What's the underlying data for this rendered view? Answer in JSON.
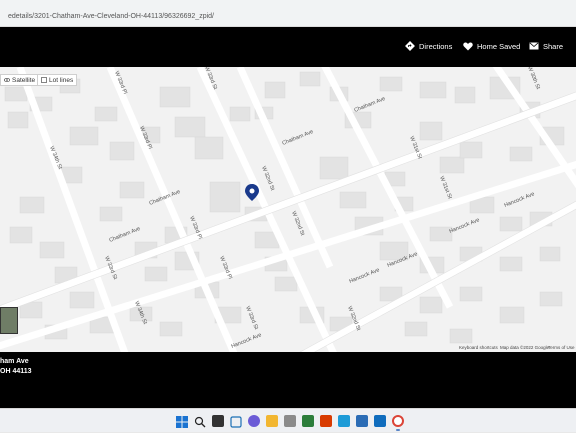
{
  "browser": {
    "url": "edetails/3201-Chatham-Ave-Cleveland-OH-44113/96326692_zpid/"
  },
  "header": {
    "directions_label": "Directions",
    "home_saved_label": "Home Saved",
    "share_label": "Share"
  },
  "map": {
    "satellite_label": "Satellite",
    "lot_lines_label": "Lot lines",
    "streets": {
      "chatham_ave_1": "Chatham Ave",
      "chatham_ave_2": "Chatham Ave",
      "chatham_ave_3": "Chatham Ave",
      "chatham_ave_4": "Chatham Ave",
      "hancock_ave_1": "Hancock Ave",
      "hancock_ave_2": "Hancock Ave",
      "hancock_ave_3": "Hancock Ave",
      "hancock_ave_4": "Hancock Ave",
      "w_33rd_pl_1": "W 33rd Pl",
      "w_33rd_pl_2": "W 33rd Pl",
      "w_33rd_pl_3": "W 33rd Pl",
      "w_33rd_pl_4": "W 33rd Pl",
      "w_32nd_st_1": "W 32nd St",
      "w_32nd_st_2": "W 32nd St",
      "w_32nd_st_3": "W 32nd St",
      "w_31st_st_1": "W 31st St",
      "w_31st_st_2": "W 31st St",
      "w_30th_st": "W 30th St",
      "w_33rd_st_1": "W 33rd St",
      "w_33rd_st_2": "W 33rd St",
      "w_33rd_st_3": "W 33rd St",
      "w_34th_st_1": "W 34th St",
      "w_34th_st_2": "W 34th St"
    },
    "attribution": {
      "shortcuts": "Keyboard shortcuts",
      "map_data": "Map data ©2022 Google",
      "terms": "Terms of Use"
    },
    "marker_color": "#1a3a8c"
  },
  "listing": {
    "street_partial": "ham Ave",
    "city_partial": "OH 44113"
  },
  "colors": {
    "header_bg": "#000000",
    "map_bg": "#f2f2f2",
    "road": "#ffffff",
    "building": "#e4e4e4"
  }
}
